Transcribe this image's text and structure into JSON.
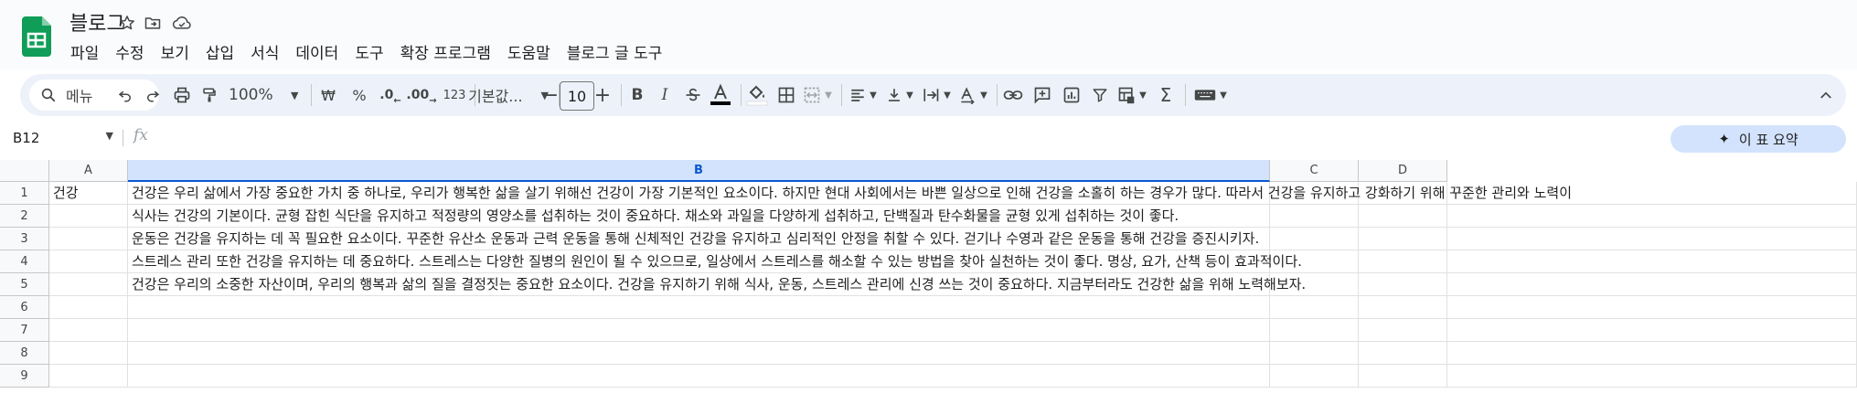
{
  "app": {
    "title": "블로그",
    "icons": [
      "star-icon",
      "move-to-folder-icon",
      "cloud-status-icon"
    ]
  },
  "menu": [
    "파일",
    "수정",
    "보기",
    "삽입",
    "서식",
    "데이터",
    "도구",
    "확장 프로그램",
    "도움말",
    "블로그 글 도구"
  ],
  "toolbar": {
    "search_label": "메뉴",
    "zoom": "100%",
    "currency": "₩",
    "percent": "%",
    "decrease_decimal": ".0",
    "increase_decimal": ".00",
    "number_format": "123",
    "font": "기본값...",
    "font_size": "10",
    "minus": "−",
    "plus": "+",
    "bold": "B",
    "italic": "I",
    "sum": "Σ"
  },
  "formula_bar": {
    "cell_ref": "B12",
    "fx": "fx",
    "summary_button": "이 표 요약"
  },
  "grid": {
    "columns": [
      "A",
      "B",
      "C",
      "D"
    ],
    "selected_column": "B",
    "rows": [
      {
        "num": "1",
        "a": "건강",
        "b": "건강은 우리 삶에서 가장 중요한 가치 중 하나로, 우리가 행복한 삶을 살기 위해선 건강이 가장 기본적인 요소이다. 하지만 현대 사회에서는 바쁜 일상으로 인해 건강을 소홀히 하는 경우가 많다. 따라서 건강을 유지하고 강화하기 위해 꾸준한 관리와 노력이"
      },
      {
        "num": "2",
        "a": "",
        "b": "식사는 건강의 기본이다. 균형 잡힌 식단을 유지하고 적정량의 영양소를 섭취하는 것이 중요하다. 채소와 과일을 다양하게 섭취하고, 단백질과 탄수화물을 균형 있게 섭취하는 것이 좋다."
      },
      {
        "num": "3",
        "a": "",
        "b": "운동은 건강을 유지하는 데 꼭 필요한 요소이다. 꾸준한 유산소 운동과 근력 운동을 통해 신체적인 건강을 유지하고 심리적인 안정을 취할 수 있다. 걷기나 수영과 같은 운동을 통해 건강을 증진시키자."
      },
      {
        "num": "4",
        "a": "",
        "b": "스트레스 관리 또한 건강을 유지하는 데 중요하다. 스트레스는 다양한 질병의 원인이 될 수 있으므로, 일상에서 스트레스를 해소할 수 있는 방법을 찾아 실천하는 것이 좋다. 명상, 요가, 산책 등이 효과적이다."
      },
      {
        "num": "5",
        "a": "",
        "b": "건강은 우리의 소중한 자산이며, 우리의 행복과 삶의 질을 결정짓는 중요한 요소이다. 건강을 유지하기 위해 식사, 운동, 스트레스 관리에 신경 쓰는 것이 중요하다. 지금부터라도 건강한 삶을 위해 노력해보자."
      },
      {
        "num": "6",
        "a": "",
        "b": ""
      },
      {
        "num": "7",
        "a": "",
        "b": ""
      },
      {
        "num": "8",
        "a": "",
        "b": ""
      },
      {
        "num": "9",
        "a": "",
        "b": ""
      }
    ]
  },
  "colors": {
    "accent": "#0b57d0",
    "toolbar_bg": "#edf2fa",
    "selection_bg": "#d3e3fd",
    "sheets_green": "#0f9d58"
  }
}
